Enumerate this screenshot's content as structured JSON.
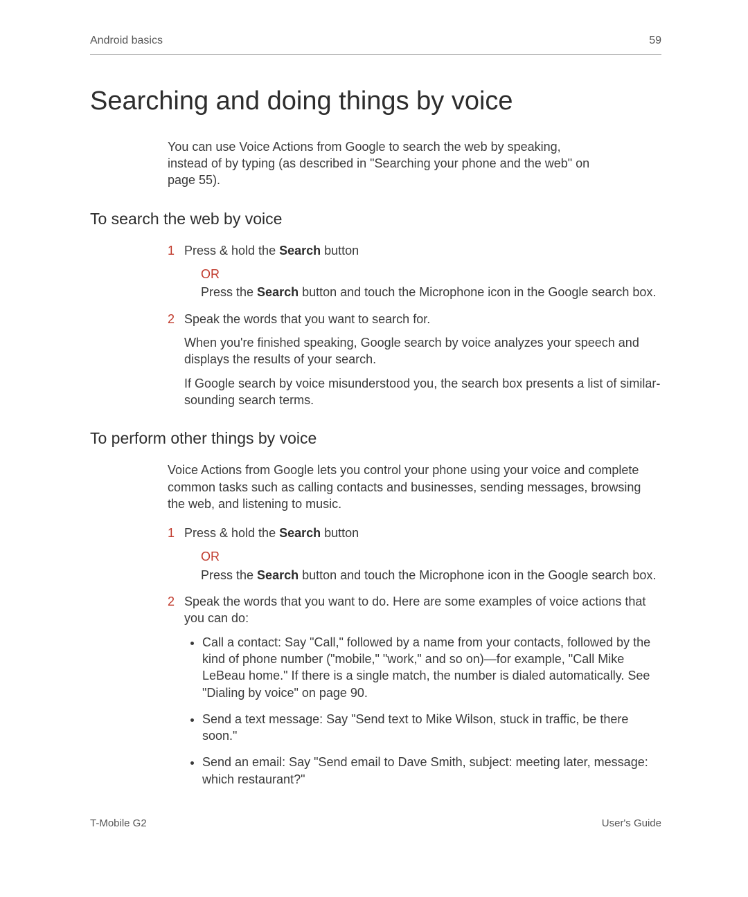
{
  "header": {
    "left": "Android basics",
    "right": "59"
  },
  "title": "Searching and doing things by voice",
  "intro": "You can use Voice Actions from Google to search the web by speaking, instead of by typing (as described in \"Searching your phone and the web\" on page 55).",
  "section1": {
    "heading": "To search the web by voice",
    "step1_num": "1",
    "step1_a_pre": "Press & hold the ",
    "step1_a_bold": "Search",
    "step1_a_post": " button",
    "or": "OR",
    "step1_b_pre": "Press the ",
    "step1_b_bold": "Search",
    "step1_b_mid": " button       and touch the Microphone icon        in the Google search box.",
    "step2_num": "2",
    "step2_a": "Speak the words that you want to search for.",
    "step2_b": "When you're finished speaking, Google search by voice analyzes your speech and displays the results of your search.",
    "step2_c": "If Google search by voice misunderstood you, the search box presents a list of similar-sounding search terms."
  },
  "section2": {
    "heading": "To perform other things by voice",
    "intro": "Voice Actions from Google lets you control your phone using your voice and complete common tasks such as calling contacts and businesses, sending messages, browsing the web, and listening to music.",
    "step1_num": "1",
    "step1_a_pre": "Press & hold the ",
    "step1_a_bold": "Search",
    "step1_a_post": " button",
    "or": "OR",
    "step1_b_pre": "Press the ",
    "step1_b_bold": "Search",
    "step1_b_mid": " button       and touch the Microphone icon        in the Google search box.",
    "step2_num": "2",
    "step2_a": "Speak the words that you want to do. Here are some examples of voice actions that you can do:",
    "bullets": [
      "Call a contact: Say \"Call,\" followed by a name from your contacts, followed by the kind of phone number (\"mobile,\" \"work,\" and so on)—for example, \"Call Mike LeBeau home.\" If there is a single match, the number is dialed automatically. See \"Dialing by voice\" on page 90.",
      "Send a text message: Say \"Send text to Mike Wilson, stuck in traffic, be there soon.\"",
      "Send an email: Say \"Send email to Dave Smith, subject: meeting later, message: which restaurant?\""
    ]
  },
  "footer": {
    "left": "T-Mobile G2",
    "right": "User's Guide"
  }
}
